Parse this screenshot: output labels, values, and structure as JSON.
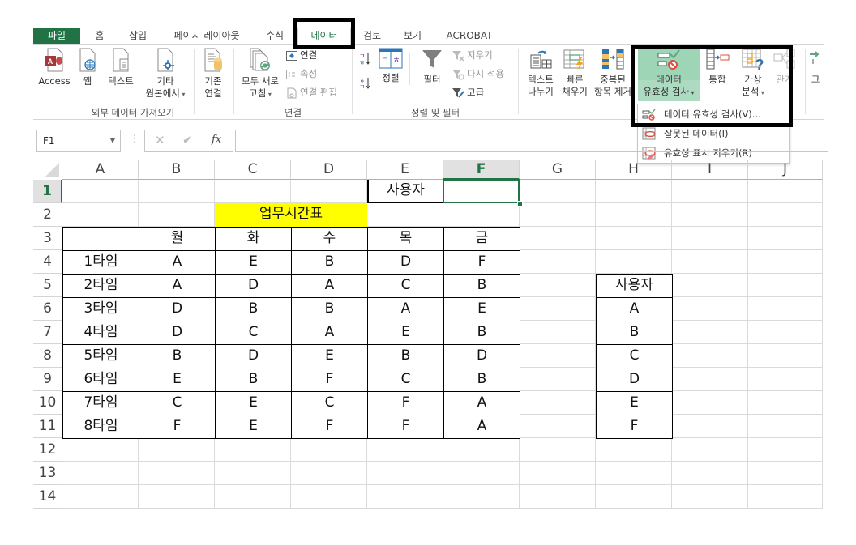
{
  "tabs": [
    {
      "label": "파일",
      "id": "file"
    },
    {
      "label": "홈",
      "id": "home"
    },
    {
      "label": "삽입",
      "id": "insert"
    },
    {
      "label": "페이지 레이아웃",
      "id": "page-layout"
    },
    {
      "label": "수식",
      "id": "formulas"
    },
    {
      "label": "데이터",
      "id": "data",
      "active": true
    },
    {
      "label": "검토",
      "id": "review"
    },
    {
      "label": "보기",
      "id": "view"
    },
    {
      "label": "ACROBAT",
      "id": "acrobat"
    }
  ],
  "ribbon": {
    "groups": {
      "external": "외부 데이터 가져오기",
      "connections": "연결",
      "sort_filter": "정렬 및 필터"
    },
    "access": "Access",
    "web": "웹",
    "text": "텍스트",
    "other_l1": "기타",
    "other_l2": "원본에서",
    "existing_l1": "기존",
    "existing_l2": "연결",
    "refresh_l1": "모두 새로",
    "refresh_l2": "고침",
    "conn": "연결",
    "props": "속성",
    "edit_links": "연결 편집",
    "sort": "정렬",
    "filter": "필터",
    "clear": "지우기",
    "reapply": "다시 적용",
    "advanced": "고급",
    "t2c_l1": "텍스트",
    "t2c_l2": "나누기",
    "flash_l1": "빠른",
    "flash_l2": "채우기",
    "dup_l1": "중복된",
    "dup_l2": "항목 제거",
    "dv_l1": "데이터",
    "dv_l2": "유효성 검사",
    "consolidate": "통합",
    "whatif_l1": "가상",
    "whatif_l2": "분석",
    "relations": "관계",
    "group_cut": "그"
  },
  "dropdown": {
    "items": [
      {
        "label": "데이터 유효성 검사(V)..."
      },
      {
        "label": "잘못된 데이터(I)"
      },
      {
        "label": "유효성 표시 지우기(R)"
      }
    ]
  },
  "formula_bar": {
    "name_box": "F1",
    "fx": "fx",
    "value": ""
  },
  "sheet": {
    "columns": [
      "A",
      "B",
      "C",
      "D",
      "E",
      "F",
      "G",
      "H",
      "I",
      "J"
    ],
    "rows": [
      "1",
      "2",
      "3",
      "4",
      "5",
      "6",
      "7",
      "8",
      "9",
      "10",
      "11",
      "12",
      "13",
      "14"
    ],
    "selected_cell": "F1",
    "e1": "사용자",
    "title": "업무시간표",
    "title_bg": "#ffff00",
    "header": [
      "월",
      "화",
      "수",
      "목",
      "금"
    ],
    "slots": [
      "1타임",
      "2타임",
      "3타임",
      "4타임",
      "5타임",
      "6타임",
      "7타임",
      "8타임"
    ],
    "schedule": [
      [
        "A",
        "E",
        "B",
        "D",
        "F"
      ],
      [
        "A",
        "D",
        "A",
        "C",
        "B"
      ],
      [
        "D",
        "B",
        "B",
        "A",
        "E"
      ],
      [
        "D",
        "C",
        "A",
        "E",
        "B"
      ],
      [
        "B",
        "D",
        "E",
        "B",
        "D"
      ],
      [
        "E",
        "B",
        "F",
        "C",
        "B"
      ],
      [
        "C",
        "E",
        "C",
        "F",
        "A"
      ],
      [
        "F",
        "E",
        "F",
        "F",
        "A"
      ]
    ],
    "user_list_header": "사용자",
    "users": [
      "A",
      "B",
      "C",
      "D",
      "E",
      "F"
    ]
  },
  "colors": {
    "accent": "#217346",
    "highlight": "#9fd5b7"
  }
}
